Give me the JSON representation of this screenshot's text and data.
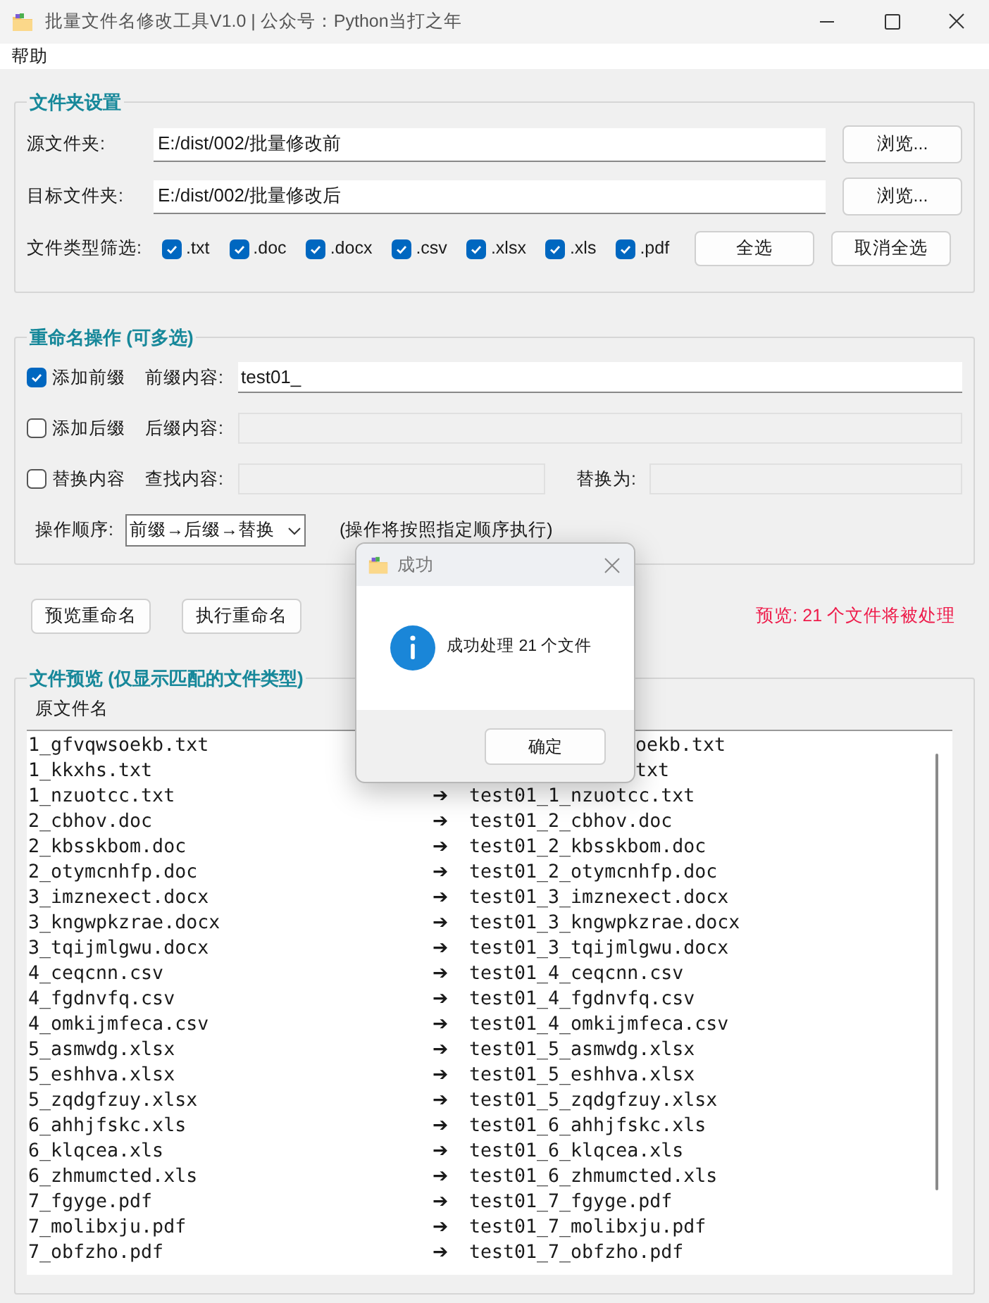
{
  "window": {
    "title": "批量文件名修改工具V1.0 | 公众号：Python当打之年"
  },
  "menu": [
    "帮助"
  ],
  "folder_settings": {
    "title": "文件夹设置",
    "source": {
      "label": "源文件夹:",
      "value": "E:/dist/002/批量修改前",
      "button": "浏览..."
    },
    "target": {
      "label": "目标文件夹:",
      "value": "E:/dist/002/批量修改后",
      "button": "浏览..."
    },
    "file_types": {
      "label": "文件类型筛选:",
      "types": [
        {
          "label": ".txt",
          "checked": true
        },
        {
          "label": ".doc",
          "checked": true
        },
        {
          "label": ".docx",
          "checked": true
        },
        {
          "label": ".csv",
          "checked": true
        },
        {
          "label": ".xlsx",
          "checked": true
        },
        {
          "label": ".xls",
          "checked": true
        },
        {
          "label": ".pdf",
          "checked": true
        }
      ],
      "buttons": [
        "全选",
        "取消全选"
      ]
    }
  },
  "rename_operations": {
    "title": "重命名操作 (可多选)",
    "options": [
      {
        "label": "添加前缀",
        "checked": true,
        "fields": [
          {
            "label": "前缀内容:",
            "value": "test01_",
            "disabled": false
          }
        ]
      },
      {
        "label": "添加后缀",
        "checked": false,
        "fields": [
          {
            "label": "后缀内容:",
            "disabled": true
          }
        ]
      },
      {
        "label": "替换内容",
        "checked": false,
        "fields": [
          {
            "label": "查找内容:",
            "disabled": true
          },
          {
            "label": "替换为:",
            "disabled": true
          }
        ]
      }
    ],
    "order": {
      "label": "操作顺序:",
      "value": "前缀→后缀→替换",
      "note": "(操作将按照指定顺序执行)"
    }
  },
  "actions": {
    "buttons": [
      "预览重命名",
      "执行重命名"
    ],
    "status": "预览: 21 个文件将被处理"
  },
  "preview": {
    "title": "文件预览 (仅显示匹配的文件类型)",
    "column_header": "原文件名",
    "rows": [
      {
        "kind": "covered",
        "original": "1_gfvqwsoekb.txt",
        "new_name": "oekb.txt"
      },
      {
        "kind": "covered",
        "original": "1_kkxhs.txt",
        "new_name": "txt"
      },
      {
        "kind": "full",
        "original": "1_nzuotcc.txt",
        "arrow": "➔",
        "new_name": "test01_1_nzuotcc.txt"
      },
      {
        "kind": "full",
        "original": "2_cbhov.doc",
        "arrow": "➔",
        "new_name": "test01_2_cbhov.doc"
      },
      {
        "kind": "full",
        "original": "2_kbsskbom.doc",
        "arrow": "➔",
        "new_name": "test01_2_kbsskbom.doc"
      },
      {
        "kind": "full",
        "original": "2_otymcnhfp.doc",
        "arrow": "➔",
        "new_name": "test01_2_otymcnhfp.doc"
      },
      {
        "kind": "full",
        "original": "3_imznexect.docx",
        "arrow": "➔",
        "new_name": "test01_3_imznexect.docx"
      },
      {
        "kind": "full",
        "original": "3_kngwpkzrae.docx",
        "arrow": "➔",
        "new_name": "test01_3_kngwpkzrae.docx"
      },
      {
        "kind": "full",
        "original": "3_tqijmlgwu.docx",
        "arrow": "➔",
        "new_name": "test01_3_tqijmlgwu.docx"
      },
      {
        "kind": "full",
        "original": "4_ceqcnn.csv",
        "arrow": "➔",
        "new_name": "test01_4_ceqcnn.csv"
      },
      {
        "kind": "full",
        "original": "4_fgdnvfq.csv",
        "arrow": "➔",
        "new_name": "test01_4_fgdnvfq.csv"
      },
      {
        "kind": "full",
        "original": "4_omkijmfeca.csv",
        "arrow": "➔",
        "new_name": "test01_4_omkijmfeca.csv"
      },
      {
        "kind": "full",
        "original": "5_asmwdg.xlsx",
        "arrow": "➔",
        "new_name": "test01_5_asmwdg.xlsx"
      },
      {
        "kind": "full",
        "original": "5_eshhva.xlsx",
        "arrow": "➔",
        "new_name": "test01_5_eshhva.xlsx"
      },
      {
        "kind": "full",
        "original": "5_zqdgfzuy.xlsx",
        "arrow": "➔",
        "new_name": "test01_5_zqdgfzuy.xlsx"
      },
      {
        "kind": "full",
        "original": "6_ahhjfskc.xls",
        "arrow": "➔",
        "new_name": "test01_6_ahhjfskc.xls"
      },
      {
        "kind": "full",
        "original": "6_klqcea.xls",
        "arrow": "➔",
        "new_name": "test01_6_klqcea.xls"
      },
      {
        "kind": "full",
        "original": "6_zhmumcted.xls",
        "arrow": "➔",
        "new_name": "test01_6_zhmumcted.xls"
      },
      {
        "kind": "full",
        "original": "7_fgyge.pdf",
        "arrow": "➔",
        "new_name": "test01_7_fgyge.pdf"
      },
      {
        "kind": "full",
        "original": "7_molibxju.pdf",
        "arrow": "➔",
        "new_name": "test01_7_molibxju.pdf"
      },
      {
        "kind": "full",
        "original": "7_obfzho.pdf",
        "arrow": "➔",
        "new_name": "test01_7_obfzho.pdf"
      }
    ]
  },
  "dialog": {
    "title": "成功",
    "message": "成功处理 21 个文件",
    "button": "确定"
  }
}
